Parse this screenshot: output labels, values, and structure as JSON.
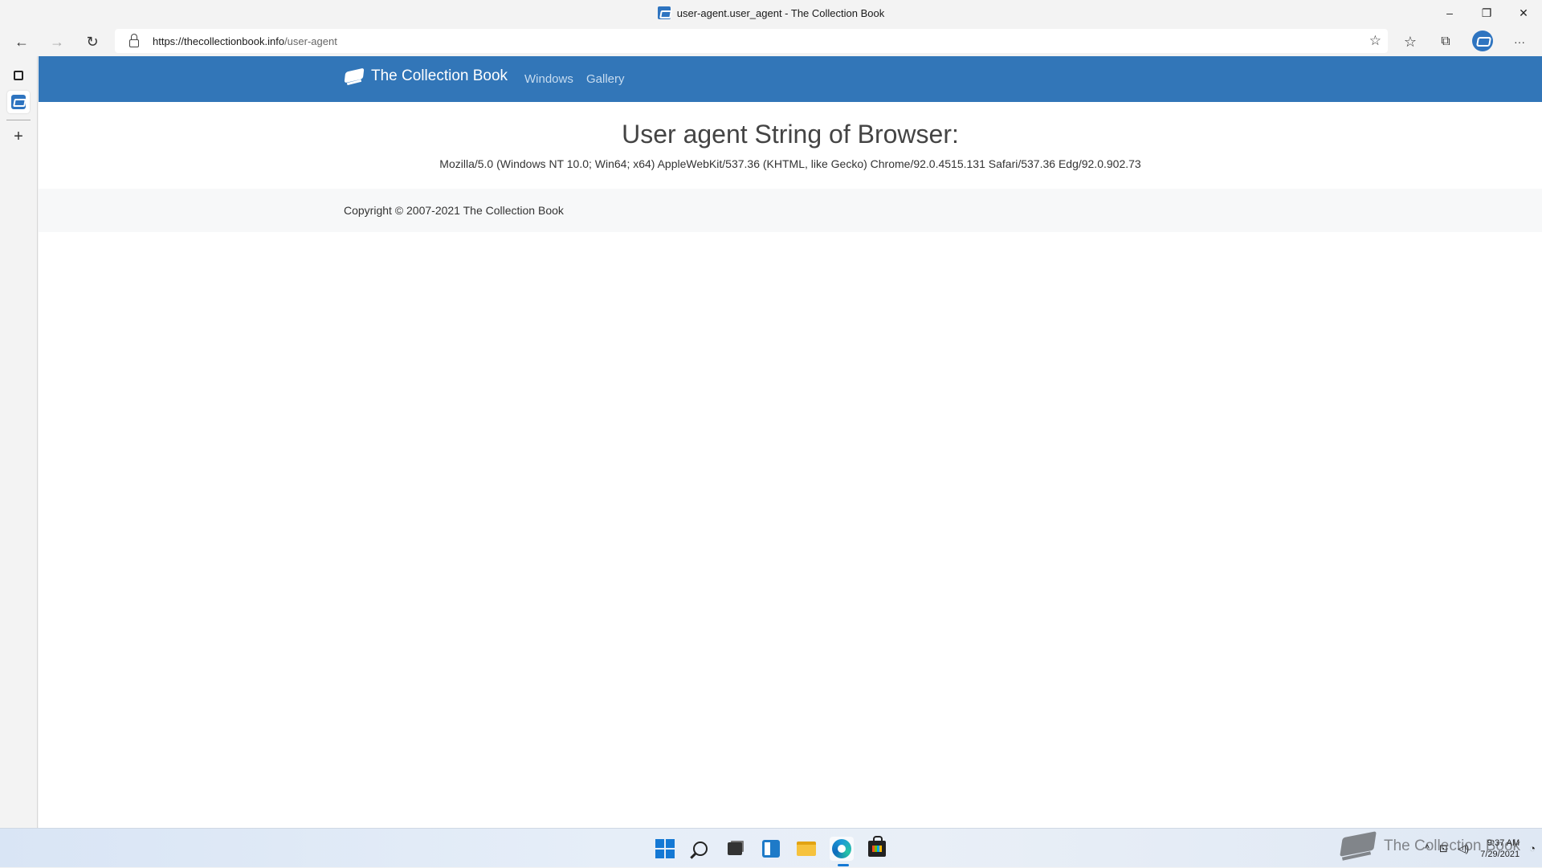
{
  "window": {
    "title": "user-agent.user_agent - The Collection Book",
    "controls": {
      "minimize": "–",
      "restore": "❐",
      "close": "✕"
    }
  },
  "toolbar": {
    "back": "←",
    "forward": "→",
    "refresh": "↻",
    "url_host": "https://thecollectionbook.info",
    "url_path": "/user-agent",
    "add_favorite": "☆",
    "favorites": "☆",
    "collections": "⧉",
    "more": "···"
  },
  "sidebar": {
    "new_tab": "+"
  },
  "site": {
    "brand": "The Collection Book",
    "nav": [
      "Windows",
      "Gallery"
    ],
    "heading": "User agent String of Browser:",
    "user_agent": "Mozilla/5.0 (Windows NT 10.0; Win64; x64) AppleWebKit/537.36 (KHTML, like Gecko) Chrome/92.0.4515.131 Safari/537.36 Edg/92.0.902.73",
    "copyright": "Copyright © 2007-2021 The Collection Book"
  },
  "taskbar": {
    "icons": [
      "start-icon",
      "search-icon",
      "task-view-icon",
      "widgets-icon",
      "file-explorer-icon",
      "edge-icon",
      "store-icon"
    ],
    "tray": {
      "chevron": "^",
      "time": "9:37 AM",
      "date": "7/29/2021"
    },
    "watermark": "The Collection Book"
  },
  "colors": {
    "navbar": "#3276b8",
    "nav_link": "#c7dcf0",
    "footer": "#f7f8f9"
  }
}
